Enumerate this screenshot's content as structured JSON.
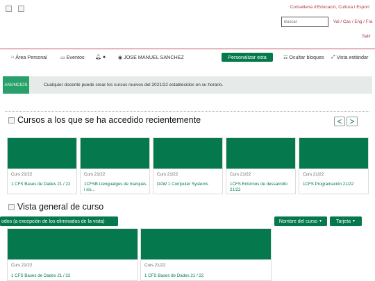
{
  "header": {
    "conselleria": "Conselleria d'Educació, Cultura i Esport",
    "search_placeholder": "Buscar",
    "lang_links": "Val / Cas / Eng / Fra",
    "exit": "Salir"
  },
  "nav": {
    "area_personal": "Área Personal",
    "eventos": "Eventos",
    "user_name": "JOSE MANUEL SANCHEZ",
    "customize": "Personalizar esta",
    "hide_blocks": "Ocultar bloques",
    "standard_view": "Vista estándar"
  },
  "announcement": {
    "tag": "ANUNCIOS",
    "text": "Cualquier docente puede crear los cursos nuevos del 2021/22 establecidos en su horario."
  },
  "recent": {
    "title": "Cursos a los que se ha accedido recientemente",
    "prev": "<",
    "next": ">",
    "courses": [
      {
        "category": "Curs 21/22",
        "name": "1 CFS Bases de Dades 21 / 22"
      },
      {
        "category": "Curs 21/22",
        "name": "1CFSB Llenguatges de marques i sis..."
      },
      {
        "category": "Curs 21/22",
        "name": "DAW 1 Computer Systems"
      },
      {
        "category": "Curs 21/22",
        "name": "1CFS Entornos de dessarrollo 21/22"
      },
      {
        "category": "Curs 21/22",
        "name": "1CFS Programación 21/22"
      }
    ]
  },
  "overview": {
    "title": "Vista general de curso",
    "filter": "odos (a excepción de los eliminados de la vista)",
    "sort": "Nombre del curso",
    "view": "Tarjeta",
    "courses": [
      {
        "category": "Curs 21/22",
        "name": "1 CFS Bases de Dades 21 / 22"
      },
      {
        "category": "Curs 21/22",
        "name": "1 CFS Bases de Dades 21 / 22"
      }
    ]
  },
  "colors": {
    "brand_green": "#05794d",
    "announcement_green": "#27a06a",
    "link_red": "#b03a4a"
  }
}
